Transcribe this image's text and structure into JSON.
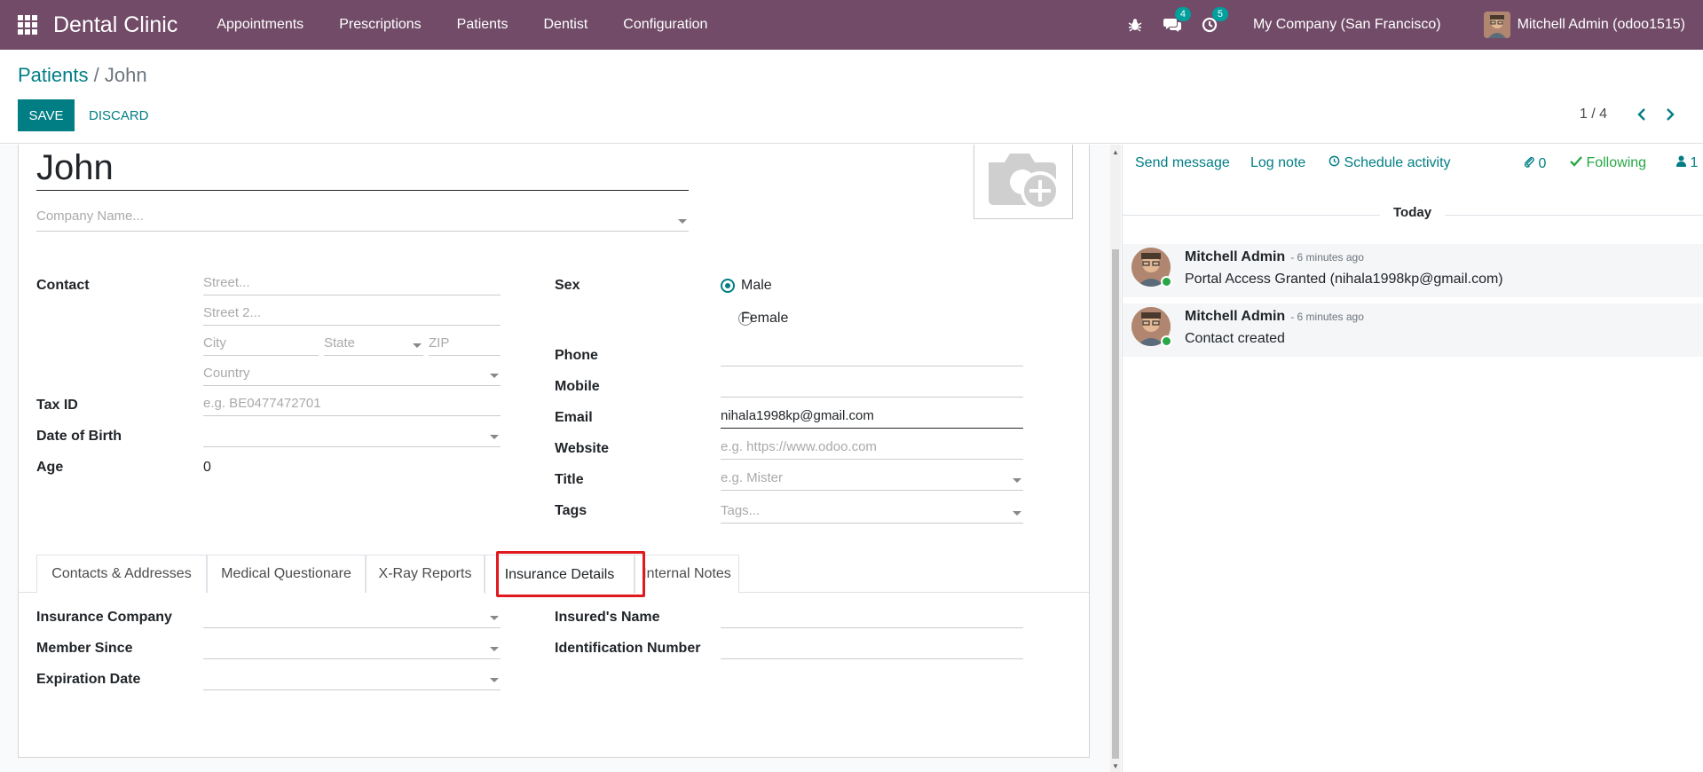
{
  "navbar": {
    "brand": "Dental Clinic",
    "menu": [
      "Appointments",
      "Prescriptions",
      "Patients",
      "Dentist",
      "Configuration"
    ],
    "messages_badge": "4",
    "activities_badge": "5",
    "company": "My Company (San Francisco)",
    "user": "Mitchell Admin (odoo1515)",
    "accent": "#714b67"
  },
  "control": {
    "breadcrumb_parent": "Patients",
    "breadcrumb_sep": "/",
    "breadcrumb_current": "John",
    "save_label": "SAVE",
    "discard_label": "DISCARD",
    "pager": "1 / 4"
  },
  "form": {
    "name": "John",
    "company_placeholder": "Company Name...",
    "contact_label": "Contact",
    "street_placeholder": "Street...",
    "street2_placeholder": "Street 2...",
    "city_placeholder": "City",
    "state_placeholder": "State",
    "zip_placeholder": "ZIP",
    "country_placeholder": "Country",
    "tax_label": "Tax ID",
    "tax_placeholder": "e.g. BE0477472701",
    "dob_label": "Date of Birth",
    "age_label": "Age",
    "age_value": "0",
    "sex_label": "Sex",
    "sex_male": "Male",
    "sex_female": "Female",
    "phone_label": "Phone",
    "mobile_label": "Mobile",
    "email_label": "Email",
    "email_value": "nihala1998kp@gmail.com",
    "website_label": "Website",
    "website_placeholder": "e.g. https://www.odoo.com",
    "title_label": "Title",
    "title_placeholder": "e.g. Mister",
    "tags_label": "Tags",
    "tags_placeholder": "Tags..."
  },
  "tabs": [
    "Contacts & Addresses",
    "Medical Questionare",
    "X-Ray Reports",
    "Insurance Details",
    "Internal Notes"
  ],
  "insurance": {
    "company_label": "Insurance Company",
    "member_label": "Member Since",
    "expiration_label": "Expiration Date",
    "insured_label": "Insured's Name",
    "id_label": "Identification Number"
  },
  "chatter": {
    "send_message": "Send message",
    "log_note": "Log note",
    "schedule": "Schedule activity",
    "attachments": "0",
    "following": "Following",
    "followers": "1",
    "today": "Today",
    "messages": [
      {
        "author": "Mitchell Admin",
        "time": "- 6 minutes ago",
        "body": "Portal Access Granted (nihala1998kp@gmail.com)"
      },
      {
        "author": "Mitchell Admin",
        "time": "- 6 minutes ago",
        "body": "Contact created"
      }
    ]
  }
}
